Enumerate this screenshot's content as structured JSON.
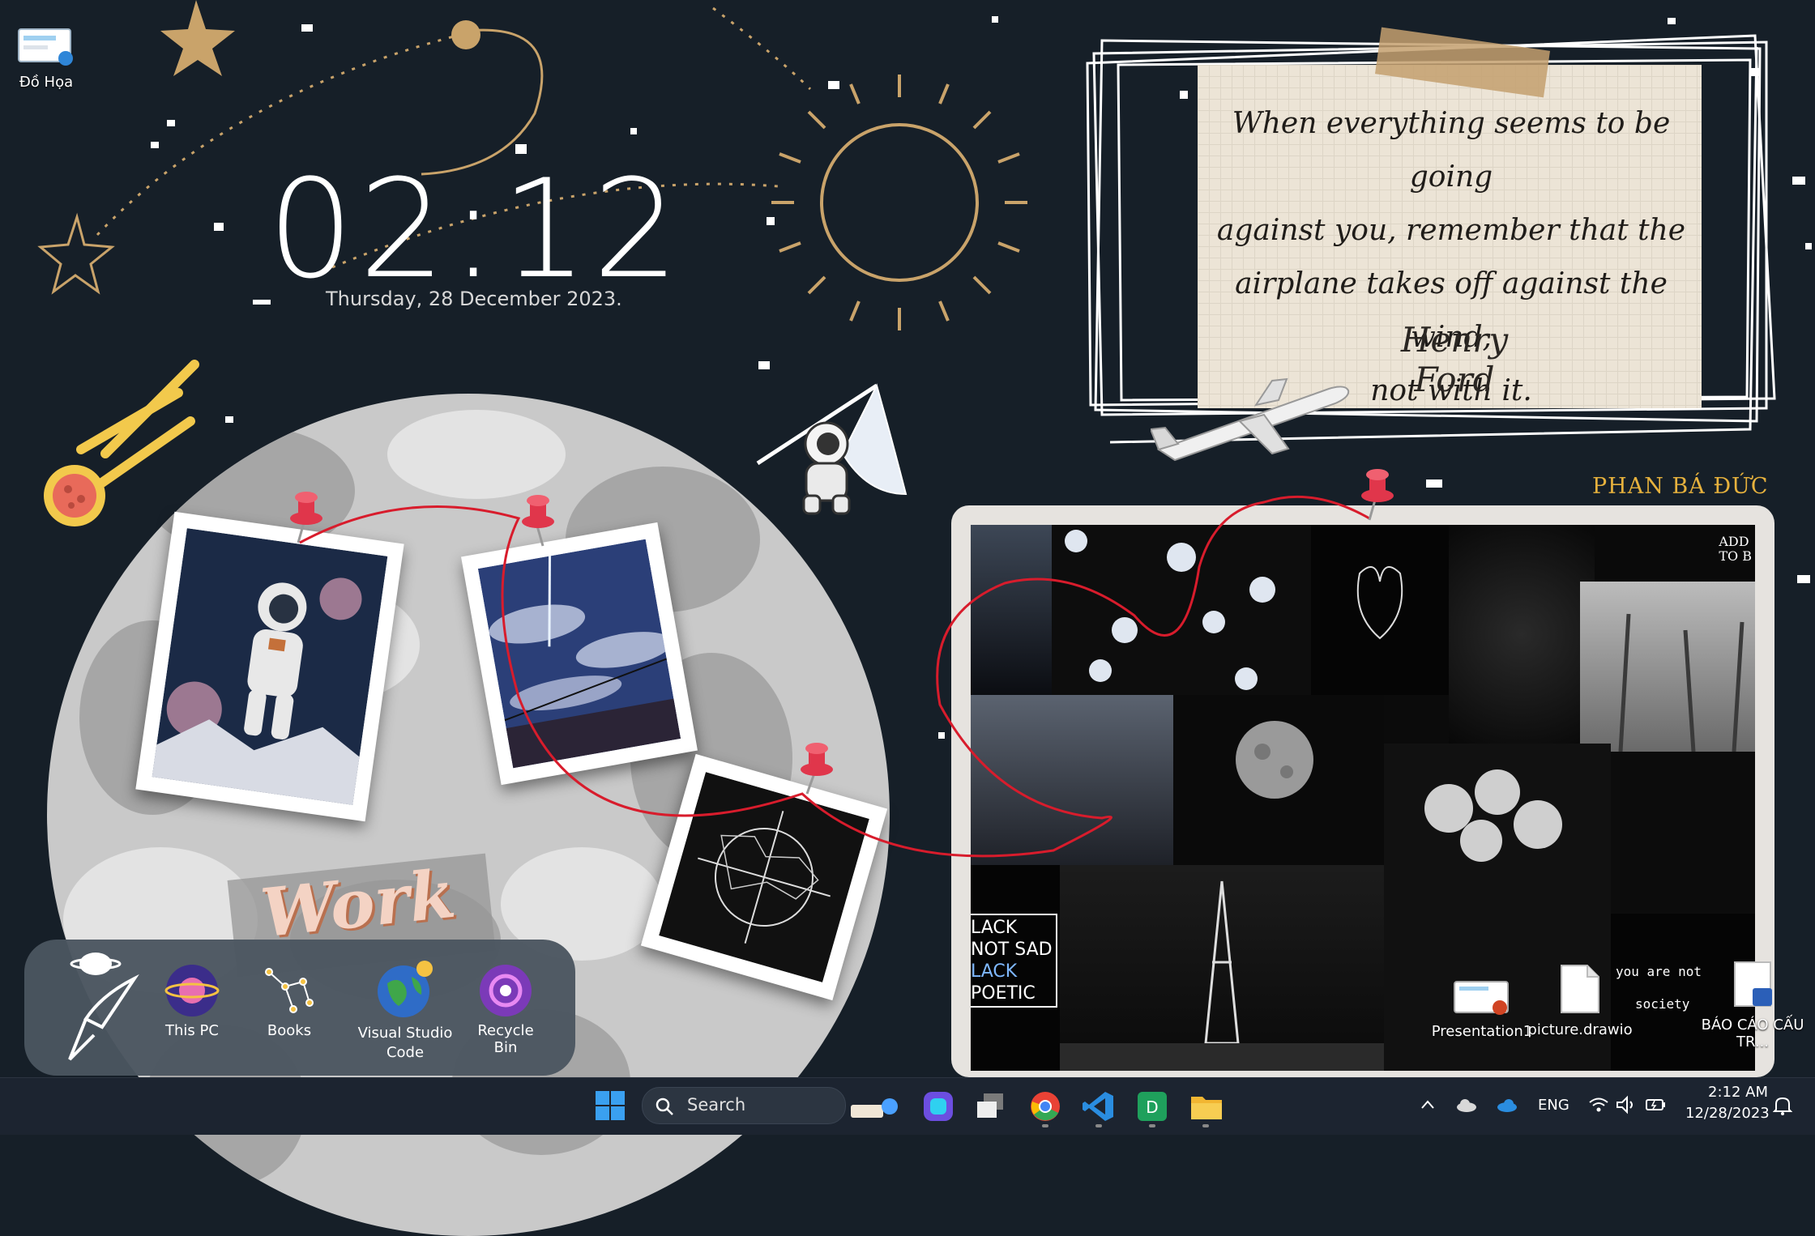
{
  "desktop_icons": {
    "do_hoa": {
      "label": "Đồ Họa"
    },
    "presentation": {
      "label": "Presentation1"
    },
    "drawio": {
      "label": "picture.drawio"
    },
    "bao_cao": {
      "label": "BÁO CÁO CẤU TR..."
    }
  },
  "clock": {
    "time": "02:12",
    "date": "Thursday, 28 December 2023."
  },
  "quote": {
    "lines": [
      "When everything seems to be going",
      "against you, remember that the",
      "airplane takes off against the wind,",
      "not with it."
    ],
    "author": "Henry Ford"
  },
  "signature": "PHAN BÁ ĐỨC",
  "moon_label": "Work",
  "board_texts": {
    "poster_lines": [
      "LACK",
      "NOT SAD",
      "LACK",
      "POETIC"
    ],
    "quote_lines": [
      "you are not",
      "society"
    ],
    "corner_lines": [
      "ADD",
      "TO B"
    ]
  },
  "dock": {
    "items": [
      {
        "label": "This PC"
      },
      {
        "label": "Books"
      },
      {
        "label": "Visual Studio Code"
      },
      {
        "label": "Recycle Bin"
      }
    ]
  },
  "taskbar": {
    "search_label": "Search",
    "lang": "ENG",
    "time": "2:12 AM",
    "date": "12/28/2023"
  },
  "colors": {
    "background": "#161f28",
    "gold": "#c9a36a",
    "pin_red": "#e0364b",
    "string_red": "#d81c2c",
    "taskbar": "#1c2430"
  }
}
